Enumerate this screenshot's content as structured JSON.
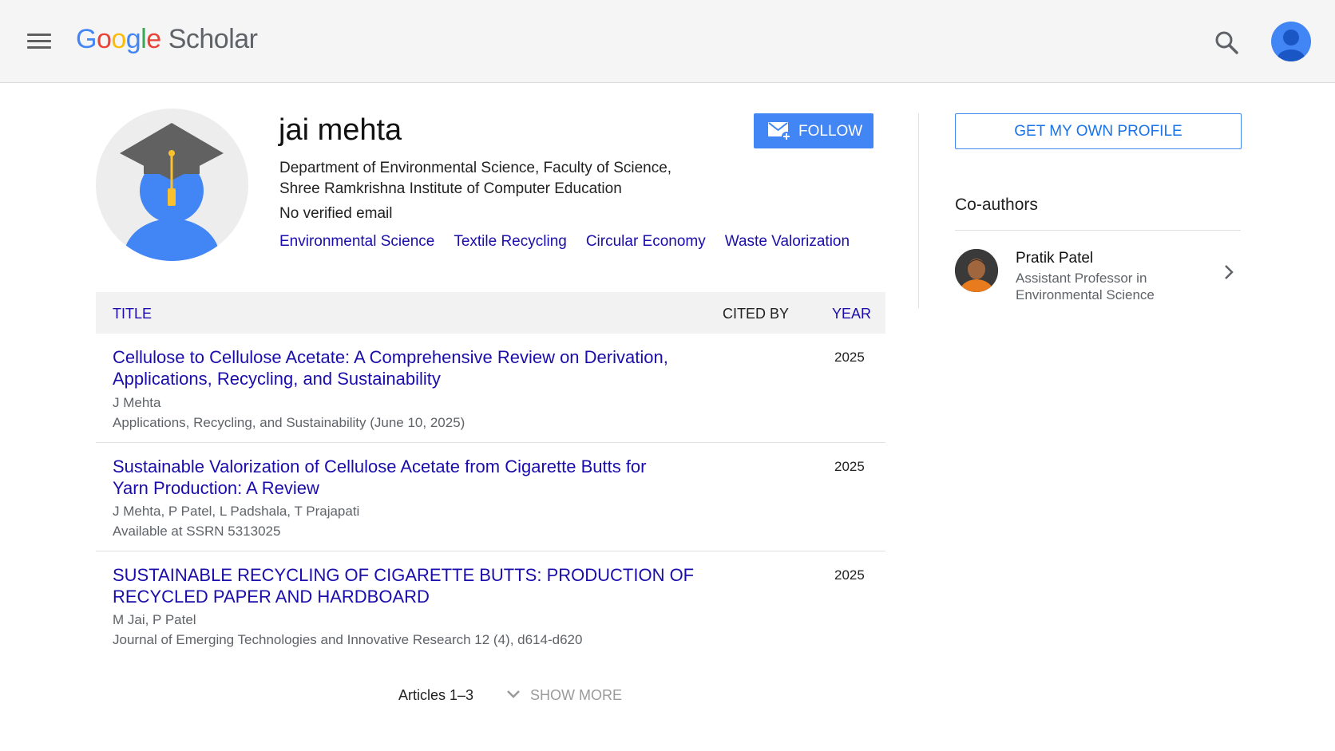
{
  "header": {
    "logo_letters": [
      {
        "ch": "G",
        "color": "#4285f4"
      },
      {
        "ch": "o",
        "color": "#ea4335"
      },
      {
        "ch": "o",
        "color": "#fbbc05"
      },
      {
        "ch": "g",
        "color": "#4285f4"
      },
      {
        "ch": "l",
        "color": "#34a853"
      },
      {
        "ch": "e",
        "color": "#ea4335"
      }
    ],
    "logo_suffix": "Scholar",
    "icons": {
      "menu": "hamburger-menu-icon",
      "search": "search-icon",
      "account": "account-avatar-icon"
    }
  },
  "profile": {
    "name": "jai mehta",
    "affiliation_line1": "Department of Environmental Science, Faculty of Science,",
    "affiliation_line2": "Shree Ramkrishna Institute of Computer Education",
    "email_status": "No verified email",
    "interests": [
      "Environmental Science",
      "Textile Recycling",
      "Circular Economy",
      "Waste Valorization"
    ],
    "follow_label": "FOLLOW"
  },
  "sidebar": {
    "get_profile_label": "GET MY OWN PROFILE",
    "coauthors_title": "Co-authors",
    "coauthors": [
      {
        "name": "Pratik Patel",
        "affiliation": "Assistant Professor in Environmental Science"
      }
    ]
  },
  "table": {
    "headers": {
      "title": "TITLE",
      "cited_by": "CITED BY",
      "year": "YEAR"
    },
    "articles": [
      {
        "title": "Cellulose to Cellulose Acetate: A Comprehensive Review on Derivation, Applications, Recycling, and Sustainability",
        "authors": "J Mehta",
        "venue": "Applications, Recycling, and Sustainability (June 10, 2025)",
        "cited_by": "",
        "year": "2025"
      },
      {
        "title": "Sustainable Valorization of Cellulose Acetate from Cigarette Butts for Yarn Production: A Review",
        "authors": "J Mehta, P Patel, L Padshala, T Prajapati",
        "venue": "Available at SSRN 5313025",
        "cited_by": "",
        "year": "2025"
      },
      {
        "title": "SUSTAINABLE RECYCLING OF CIGARETTE BUTTS: PRODUCTION OF RECYCLED PAPER AND HARDBOARD",
        "authors": "M Jai, P Patel",
        "venue": "Journal of Emerging Technologies and Innovative Research 12 (4), d614-d620",
        "cited_by": "",
        "year": "2025"
      }
    ]
  },
  "footer": {
    "articles_range": "Articles 1–3",
    "show_more_label": "SHOW MORE"
  },
  "colors": {
    "accent_blue": "#4285f4",
    "link_blue": "#1a0dab",
    "header_bg": "#f5f5f5"
  }
}
